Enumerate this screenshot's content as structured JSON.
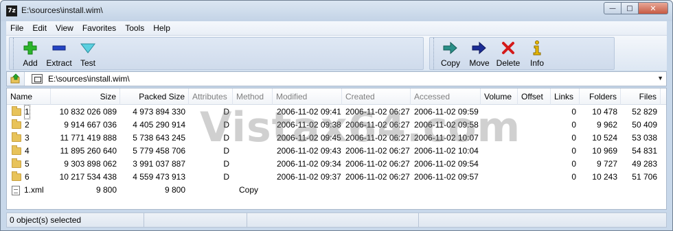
{
  "window": {
    "app_icon_text": "7z",
    "title": "E:\\sources\\install.wim\\",
    "minimize_glyph": "—",
    "maximize_glyph": "□",
    "close_glyph": "✕"
  },
  "menu": [
    "File",
    "Edit",
    "View",
    "Favorites",
    "Tools",
    "Help"
  ],
  "toolbar": {
    "group1": [
      {
        "label": "Add",
        "icon": "add-plus-icon",
        "color": "#22aa22"
      },
      {
        "label": "Extract",
        "icon": "extract-minus-icon",
        "color": "#1f3fb5"
      },
      {
        "label": "Test",
        "icon": "test-check-icon",
        "color": "#3fb8c8"
      }
    ],
    "group2": [
      {
        "label": "Copy",
        "icon": "copy-arrow-icon",
        "color": "#1e7e78"
      },
      {
        "label": "Move",
        "icon": "move-arrow-icon",
        "color": "#1a2a8a"
      },
      {
        "label": "Delete",
        "icon": "delete-x-icon",
        "color": "#d01818"
      },
      {
        "label": "Info",
        "icon": "info-icon",
        "color": "#e8b800"
      }
    ]
  },
  "address": {
    "path": "E:\\sources\\install.wim\\"
  },
  "columns": [
    "Name",
    "Size",
    "Packed Size",
    "Attributes",
    "Method",
    "Modified",
    "Created",
    "Accessed",
    "Volume",
    "Offset",
    "Links",
    "Folders",
    "Files"
  ],
  "rows": [
    {
      "type": "folder",
      "name": "1",
      "size": "10 832 026 089",
      "packed": "4 973 894 330",
      "attributes": "D",
      "method": "",
      "modified": "2006-11-02 09:41",
      "created": "2006-11-02 06:27",
      "accessed": "2006-11-02 09:59",
      "volume": "",
      "offset": "",
      "links": "0",
      "folders": "10 478",
      "files": "52 829"
    },
    {
      "type": "folder",
      "name": "2",
      "size": "9 914 667 036",
      "packed": "4 405 290 914",
      "attributes": "D",
      "method": "",
      "modified": "2006-11-02 09:38",
      "created": "2006-11-02 06:27",
      "accessed": "2006-11-02 09:58",
      "volume": "",
      "offset": "",
      "links": "0",
      "folders": "9 962",
      "files": "50 409"
    },
    {
      "type": "folder",
      "name": "3",
      "size": "11 771 419 888",
      "packed": "5 738 643 245",
      "attributes": "D",
      "method": "",
      "modified": "2006-11-02 09:45",
      "created": "2006-11-02 06:27",
      "accessed": "2006-11-02 10:07",
      "volume": "",
      "offset": "",
      "links": "0",
      "folders": "10 524",
      "files": "53 038"
    },
    {
      "type": "folder",
      "name": "4",
      "size": "11 895 260 640",
      "packed": "5 779 458 706",
      "attributes": "D",
      "method": "",
      "modified": "2006-11-02 09:43",
      "created": "2006-11-02 06:27",
      "accessed": "2006-11-02 10:04",
      "volume": "",
      "offset": "",
      "links": "0",
      "folders": "10 969",
      "files": "54 831"
    },
    {
      "type": "folder",
      "name": "5",
      "size": "9 303 898 062",
      "packed": "3 991 037 887",
      "attributes": "D",
      "method": "",
      "modified": "2006-11-02 09:34",
      "created": "2006-11-02 06:27",
      "accessed": "2006-11-02 09:54",
      "volume": "",
      "offset": "",
      "links": "0",
      "folders": "9 727",
      "files": "49 283"
    },
    {
      "type": "folder",
      "name": "6",
      "size": "10 217 534 438",
      "packed": "4 559 473 913",
      "attributes": "D",
      "method": "",
      "modified": "2006-11-02 09:37",
      "created": "2006-11-02 06:27",
      "accessed": "2006-11-02 09:57",
      "volume": "",
      "offset": "",
      "links": "0",
      "folders": "10 243",
      "files": "51 706"
    },
    {
      "type": "file",
      "name": "1.xml",
      "size": "9 800",
      "packed": "9 800",
      "attributes": "",
      "method": "Copy",
      "modified": "",
      "created": "",
      "accessed": "",
      "volume": "",
      "offset": "",
      "links": "",
      "folders": "",
      "files": ""
    }
  ],
  "watermark": "Vistax64.com",
  "status": {
    "selection": "0 object(s) selected"
  }
}
